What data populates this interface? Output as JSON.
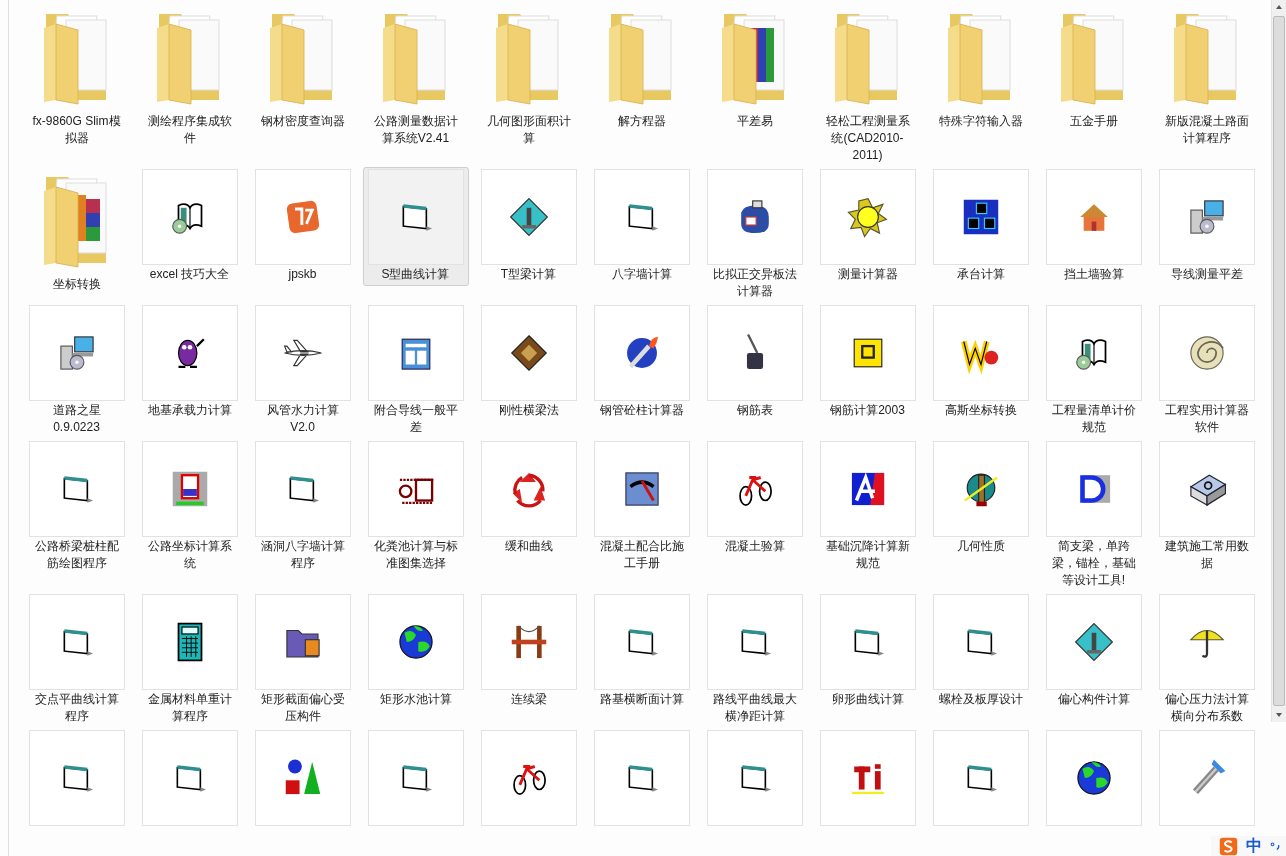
{
  "items": [
    {
      "label": "fx-9860G Slim模拟器",
      "kind": "folder",
      "selected": false
    },
    {
      "label": "测绘程序集成软件",
      "kind": "folder",
      "selected": false
    },
    {
      "label": "钢材密度查询器",
      "kind": "folder",
      "selected": false
    },
    {
      "label": "公路测量数据计算系统V2.41",
      "kind": "folder",
      "selected": false
    },
    {
      "label": "几何图形面积计算",
      "kind": "folder",
      "selected": false
    },
    {
      "label": "解方程器",
      "kind": "folder",
      "selected": false
    },
    {
      "label": "平差易",
      "kind": "folder",
      "selected": false
    },
    {
      "label": "轻松工程测量系统(CAD2010-2011)",
      "kind": "folder",
      "selected": false
    },
    {
      "label": "特殊字符输入器",
      "kind": "folder",
      "selected": false
    },
    {
      "label": "五金手册",
      "kind": "folder",
      "selected": false
    },
    {
      "label": "新版混凝土路面计算程序",
      "kind": "folder",
      "selected": false
    },
    {
      "label": "坐标转换",
      "kind": "folder",
      "selected": false
    },
    {
      "label": "excel 技巧大全",
      "kind": "file",
      "selected": false
    },
    {
      "label": "jpskb",
      "kind": "file",
      "selected": false
    },
    {
      "label": "S型曲线计算",
      "kind": "file",
      "selected": true
    },
    {
      "label": "T型梁计算",
      "kind": "file",
      "selected": false
    },
    {
      "label": "八字墙计算",
      "kind": "file",
      "selected": false
    },
    {
      "label": "比拟正交异板法计算器",
      "kind": "file",
      "selected": false
    },
    {
      "label": "测量计算器",
      "kind": "file",
      "selected": false
    },
    {
      "label": "承台计算",
      "kind": "file",
      "selected": false
    },
    {
      "label": "挡土墙验算",
      "kind": "file",
      "selected": false
    },
    {
      "label": "导线测量平差",
      "kind": "file",
      "selected": false
    },
    {
      "label": "道路之星0.9.0223",
      "kind": "file",
      "selected": false
    },
    {
      "label": "地基承载力计算",
      "kind": "file",
      "selected": false
    },
    {
      "label": "风管水力计算V2.0",
      "kind": "file",
      "selected": false
    },
    {
      "label": "附合导线一般平差",
      "kind": "file",
      "selected": false
    },
    {
      "label": "刚性横梁法",
      "kind": "file",
      "selected": false
    },
    {
      "label": "钢管砼柱计算器",
      "kind": "file",
      "selected": false
    },
    {
      "label": "钢筋表",
      "kind": "file",
      "selected": false
    },
    {
      "label": "钢筋计算2003",
      "kind": "file",
      "selected": false
    },
    {
      "label": "高斯坐标转换",
      "kind": "file",
      "selected": false
    },
    {
      "label": "工程量清单计价规范",
      "kind": "file",
      "selected": false
    },
    {
      "label": "工程实用计算器软件",
      "kind": "file",
      "selected": false
    },
    {
      "label": "公路桥梁桩柱配筋绘图程序",
      "kind": "file",
      "selected": false
    },
    {
      "label": "公路坐标计算系统",
      "kind": "file",
      "selected": false
    },
    {
      "label": "涵洞八字墙计算程序",
      "kind": "file",
      "selected": false
    },
    {
      "label": "化粪池计算与标准图集选择",
      "kind": "file",
      "selected": false
    },
    {
      "label": "缓和曲线",
      "kind": "file",
      "selected": false
    },
    {
      "label": "混凝土配合比施工手册",
      "kind": "file",
      "selected": false
    },
    {
      "label": "混凝土验算",
      "kind": "file",
      "selected": false
    },
    {
      "label": "基础沉降计算新规范",
      "kind": "file",
      "selected": false
    },
    {
      "label": "几何性质",
      "kind": "file",
      "selected": false
    },
    {
      "label": "简支梁，单跨梁，锚栓，基础等设计工具!",
      "kind": "file",
      "selected": false
    },
    {
      "label": "建筑施工常用数据",
      "kind": "file",
      "selected": false
    },
    {
      "label": "交点平曲线计算程序",
      "kind": "file",
      "selected": false
    },
    {
      "label": "金属材料单重计算程序",
      "kind": "file",
      "selected": false
    },
    {
      "label": "矩形截面偏心受压构件",
      "kind": "file",
      "selected": false
    },
    {
      "label": "矩形水池计算",
      "kind": "file",
      "selected": false
    },
    {
      "label": "连续梁",
      "kind": "file",
      "selected": false
    },
    {
      "label": "路基横断面计算",
      "kind": "file",
      "selected": false
    },
    {
      "label": "路线平曲线最大横净距计算",
      "kind": "file",
      "selected": false
    },
    {
      "label": "卵形曲线计算",
      "kind": "file",
      "selected": false
    },
    {
      "label": "螺栓及板厚设计",
      "kind": "file",
      "selected": false
    },
    {
      "label": "偏心构件计算",
      "kind": "file",
      "selected": false
    },
    {
      "label": "偏心压力法计算横向分布系数",
      "kind": "file",
      "selected": false
    },
    {
      "kind": "file",
      "selected": false
    },
    {
      "kind": "file",
      "selected": false
    },
    {
      "kind": "file",
      "selected": false
    },
    {
      "kind": "file",
      "selected": false
    },
    {
      "kind": "file",
      "selected": false
    },
    {
      "kind": "file",
      "selected": false
    },
    {
      "kind": "file",
      "selected": false
    },
    {
      "kind": "file",
      "selected": false
    },
    {
      "kind": "file",
      "selected": false
    },
    {
      "kind": "file",
      "selected": false
    },
    {
      "kind": "file",
      "selected": false
    }
  ],
  "ime": {
    "mode": "中"
  }
}
